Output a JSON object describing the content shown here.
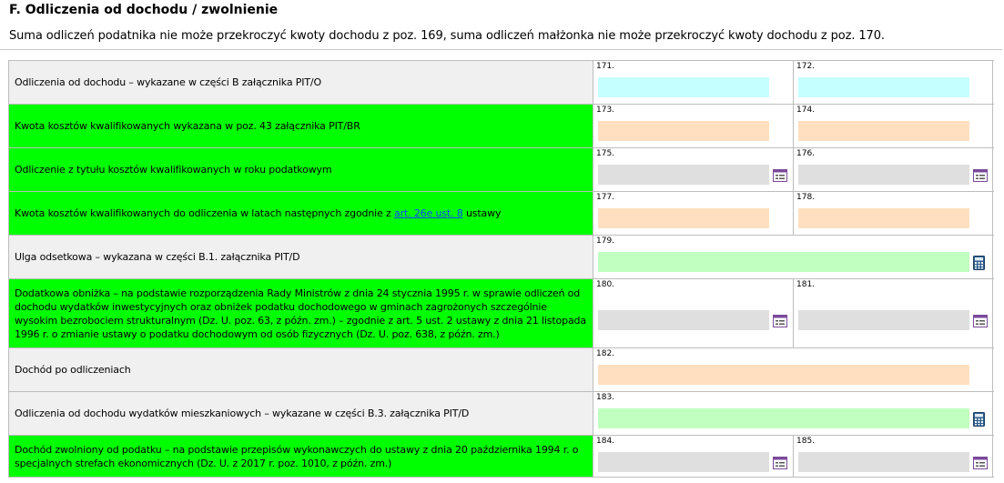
{
  "section": {
    "title": "F. Odliczenia od dochodu / zwolnienie",
    "note": "Suma odliczeń podatnika nie może przekroczyć kwoty dochodu z poz. 169, suma odliczeń małżonka nie może przekroczyć kwoty dochodu z poz. 170."
  },
  "rows": [
    {
      "label": "Odliczenia od dochodu – wykazane w części B załącznika PIT/O",
      "field_a": {
        "number": "171.",
        "value": ""
      },
      "field_b": {
        "number": "172.",
        "value": ""
      }
    },
    {
      "label": "Kwota kosztów kwalifikowanych wykazana w poz. 43 załącznika PIT/BR",
      "field_a": {
        "number": "173.",
        "value": ""
      },
      "field_b": {
        "number": "174.",
        "value": ""
      }
    },
    {
      "label": "Odliczenie z tytułu kosztów kwalifikowanych w roku podatkowym",
      "field_a": {
        "number": "175.",
        "value": ""
      },
      "field_b": {
        "number": "176.",
        "value": ""
      }
    },
    {
      "label_before": "Kwota kosztów kwalifikowanych do odliczenia w latach następnych zgodnie z ",
      "label_link": "art. 26e ust. 8",
      "label_after": " ustawy",
      "field_a": {
        "number": "177.",
        "value": ""
      },
      "field_b": {
        "number": "178.",
        "value": ""
      }
    },
    {
      "label": "Ulga odsetkowa – wykazana w części B.1. załącznika PIT/D",
      "field": {
        "number": "179.",
        "value": ""
      }
    },
    {
      "label": "Dodatkowa obniżka – na podstawie rozporządzenia Rady Ministrów z dnia 24 stycznia 1995 r. w sprawie odliczeń od dochodu wydatków inwestycyjnych oraz obniżek podatku dochodowego w gminach zagrożonych szczególnie wysokim bezrobociem strukturalnym (Dz. U. poz. 63, z późn. zm.) – zgodnie z art. 5 ust. 2 ustawy z dnia 21 listopada 1996 r. o zmianie ustawy o podatku dochodowym od osób fizycznych (Dz. U. poz. 638, z późn. zm.)",
      "field_a": {
        "number": "180.",
        "value": ""
      },
      "field_b": {
        "number": "181.",
        "value": ""
      }
    },
    {
      "label": "Dochód po odliczeniach",
      "field": {
        "number": "182.",
        "value": ""
      }
    },
    {
      "label": "Odliczenia od dochodu wydatków mieszkaniowych – wykazane w części B.3. załącznika PIT/D",
      "field": {
        "number": "183.",
        "value": ""
      }
    },
    {
      "label": "Dochód zwolniony od podatku – na podstawie przepisów wykonawczych do ustawy z dnia 20 października 1994 r. o specjalnych strefach ekonomicznych (Dz. U. z 2017 r. poz. 1010, z późn. zm.)",
      "field_a": {
        "number": "184.",
        "value": ""
      },
      "field_b": {
        "number": "185.",
        "value": ""
      }
    }
  ],
  "icons": {
    "list": "list-picker-icon",
    "calc": "calculator-icon"
  },
  "colors": {
    "label_grey": "#f0f0f0",
    "label_green": "#00ff00",
    "field_cyan": "#c5ffff",
    "field_peach": "#ffdfbf",
    "field_grey": "#dfdfdf",
    "field_light_green": "#c0ffc0",
    "link": "#0645ff"
  }
}
